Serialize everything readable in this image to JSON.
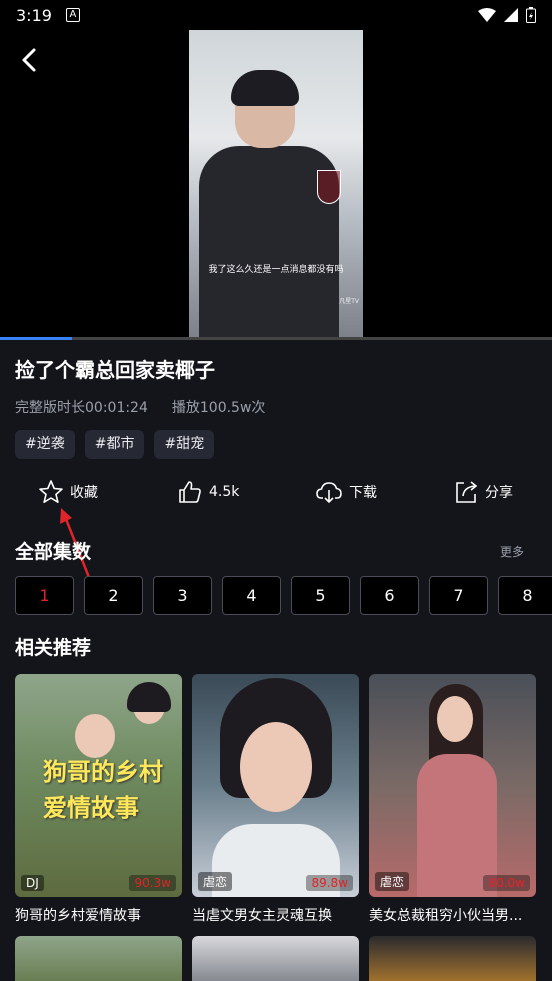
{
  "status_bar": {
    "time": "3:19",
    "notif_icon": "A"
  },
  "video": {
    "subtitle": "我了这么久还是一点消息都没有吗",
    "watermark": "凡星TV",
    "progress": 0.13
  },
  "drama": {
    "title": "捡了个霸总回家卖椰子",
    "duration": "完整版时长00:01:24",
    "plays": "播放100.5w次",
    "tags": [
      "#逆袭",
      "#都市",
      "#甜宠"
    ]
  },
  "actions": {
    "favorite": "收藏",
    "like": "4.5k",
    "download": "下载",
    "share": "分享"
  },
  "episodes": {
    "title": "全部集数",
    "more": "更多",
    "list": [
      "1",
      "2",
      "3",
      "4",
      "5",
      "6",
      "7",
      "8"
    ],
    "active": "1"
  },
  "recommend": {
    "title": "相关推荐",
    "cards": [
      {
        "title": "狗哥的乡村爱情故事",
        "badge": "DJ",
        "plays": "90.3w",
        "poster_text": "狗哥的乡村爱情故事"
      },
      {
        "title": "当虐文男女主灵魂互换",
        "badge": "虐恋",
        "plays": "89.8w",
        "poster_text": ""
      },
      {
        "title": "美女总裁租穷小伙当男...",
        "badge": "虐恋",
        "plays": "80.0w",
        "poster_text": ""
      }
    ]
  },
  "colors": {
    "accent_red": "#e0242b",
    "progress_blue": "#3a82f7",
    "bg": "#14151b"
  }
}
